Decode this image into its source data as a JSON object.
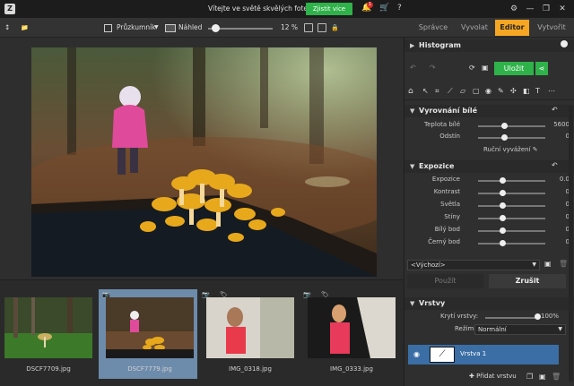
{
  "titlebar": {
    "logo": "Z",
    "welcome": "Vítejte ve světě skvělých fotek",
    "cta": "Zjistit více",
    "notification_count": "1",
    "bell_icon": "🔔",
    "cart_icon": "🛒",
    "help_icon": "?",
    "settings_icon": "⚙",
    "minimize_icon": "—",
    "maximize_icon": "❐",
    "close_icon": "✕"
  },
  "toolbar": {
    "sort_icon": "↕",
    "folder_icon": "📁",
    "browser_label": "Průzkumník",
    "preview_label": "Náhled",
    "zoom": "12 %",
    "lock_icon": "🔒"
  },
  "tabs": [
    {
      "label": "Správce"
    },
    {
      "label": "Vyvolat"
    },
    {
      "label": "Editor"
    },
    {
      "label": "Vytvořit"
    }
  ],
  "filmstrip": [
    {
      "name": "DSCF7709.jpg"
    },
    {
      "name": "DSCF7779.jpg"
    },
    {
      "name": "IMG_0318.jpg"
    },
    {
      "name": "IMG_0333.jpg"
    }
  ],
  "panel": {
    "histogram": "Histogram",
    "save_label": "Uložit",
    "white_balance": {
      "title": "Vyrovnání bílé",
      "rows": [
        {
          "label": "Teplota bílé",
          "value": "5600",
          "level": 0.38
        },
        {
          "label": "Odstín",
          "value": "0",
          "level": 0.38
        }
      ],
      "manual": "Ruční vyvážení"
    },
    "exposure": {
      "title": "Expozice",
      "rows": [
        {
          "label": "Expozice",
          "value": "0.0",
          "level": 0.36
        },
        {
          "label": "Kontrast",
          "value": "0",
          "level": 0.36
        },
        {
          "label": "Světla",
          "value": "0",
          "level": 0.36
        },
        {
          "label": "Stíny",
          "value": "0",
          "level": 0.36
        },
        {
          "label": "Bílý bod",
          "value": "0",
          "level": 0.36
        },
        {
          "label": "Černý bod",
          "value": "0",
          "level": 0.36
        }
      ]
    },
    "preset": "<Výchozí>",
    "apply": "Použít",
    "cancel": "Zrušit",
    "layers": {
      "title": "Vrstvy",
      "opacity_label": "Krytí vrstvy:",
      "opacity_value": "100%",
      "opacity_level": 1.0,
      "mode_label": "Režim:",
      "mode_value": "Normální",
      "layer_name": "Vrstva 1",
      "add_layer": "Přidat vrstvu"
    }
  },
  "colors": {
    "accent": "#f5a623",
    "cta": "#2fb24a",
    "layer_selected": "#3a6ea5",
    "thumb_selected": "#6d8bab"
  }
}
